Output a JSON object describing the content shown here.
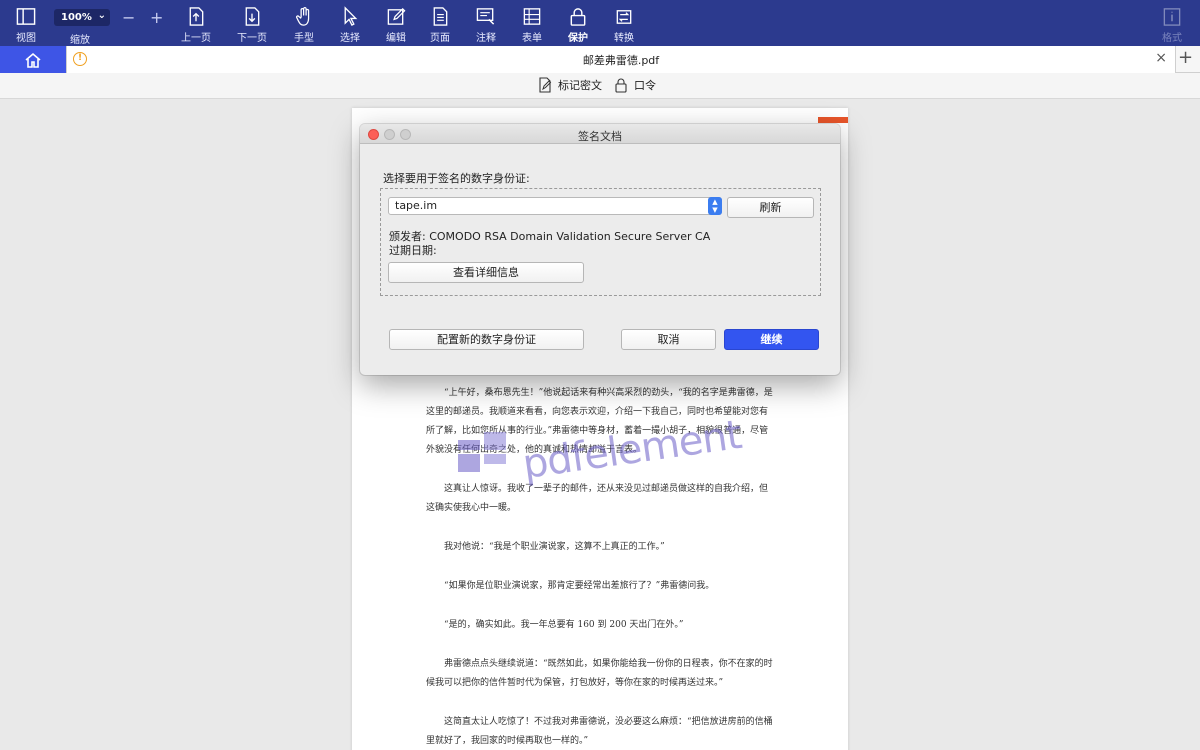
{
  "toolbar": {
    "items": [
      {
        "label": "视图",
        "icon": "sidebar-view-icon"
      },
      {
        "label": "上一页",
        "icon": "prev-page-icon"
      },
      {
        "label": "下一页",
        "icon": "next-page-icon"
      },
      {
        "label": "手型",
        "icon": "hand-icon"
      },
      {
        "label": "选择",
        "icon": "select-cursor-icon"
      },
      {
        "label": "编辑",
        "icon": "edit-icon"
      },
      {
        "label": "页面",
        "icon": "page-icon"
      },
      {
        "label": "注释",
        "icon": "comment-icon"
      },
      {
        "label": "表单",
        "icon": "form-icon"
      },
      {
        "label": "保护",
        "icon": "lock-icon"
      },
      {
        "label": "转换",
        "icon": "convert-icon"
      },
      {
        "label": "格式",
        "icon": "format-icon"
      }
    ],
    "zoom": {
      "value": "100%",
      "label": "缩放",
      "minus": "−",
      "plus": "+"
    }
  },
  "tabs": {
    "document_title": "邮差弗雷德.pdf",
    "close": "×",
    "new_tab": "+"
  },
  "subbar": {
    "redact": "标记密文",
    "password": "口令"
  },
  "dialog": {
    "title": "签名文档",
    "prompt": "选择要用于签名的数字身份证:",
    "certificate": "tape.im",
    "refresh": "刷新",
    "issuer": "颁发者: COMODO RSA Domain Validation Secure Server CA",
    "expiry": "过期日期:",
    "details": "查看详细信息",
    "configure": "配置新的数字身份证",
    "cancel": "取消",
    "continue": "继续"
  },
  "document": {
    "paragraphs": [
      "“上午好，桑布恩先生！”他说起话来有种兴高采烈的劲头，“我的名字是弗雷德，是这里的邮递员。我顺道来看看，向您表示欢迎，介绍一下我自己，同时也希望能对您有所了解，比如您所从事的行业。”弗雷德中等身材，蓄着一撮小胡子，相貌很普通，尽管外貌没有任何出奇之处，他的真诚和热情却溢于言表。",
      "这真让人惊讶。我收了一辈子的邮件，还从来没见过邮递员做这样的自我介绍，但这确实使我心中一暖。",
      "我对他说：“我是个职业演说家，这算不上真正的工作。”",
      "“如果你是位职业演说家，那肯定要经常出差旅行了？”弗雷德问我。",
      "“是的，确实如此。我一年总要有 160 到 200 天出门在外。”",
      "弗雷德点点头继续说道：“既然如此，如果你能给我一份你的日程表，你不在家的时候我可以把你的信件暂时代为保管，打包放好，等你在家的时候再送过来。”",
      "这简直太让人吃惊了！不过我对弗雷德说，没必要这么麻烦：“把信放进房前的信桶里就好了，我回家的时候再取也一样的。”"
    ],
    "watermark": "pdfelement"
  }
}
